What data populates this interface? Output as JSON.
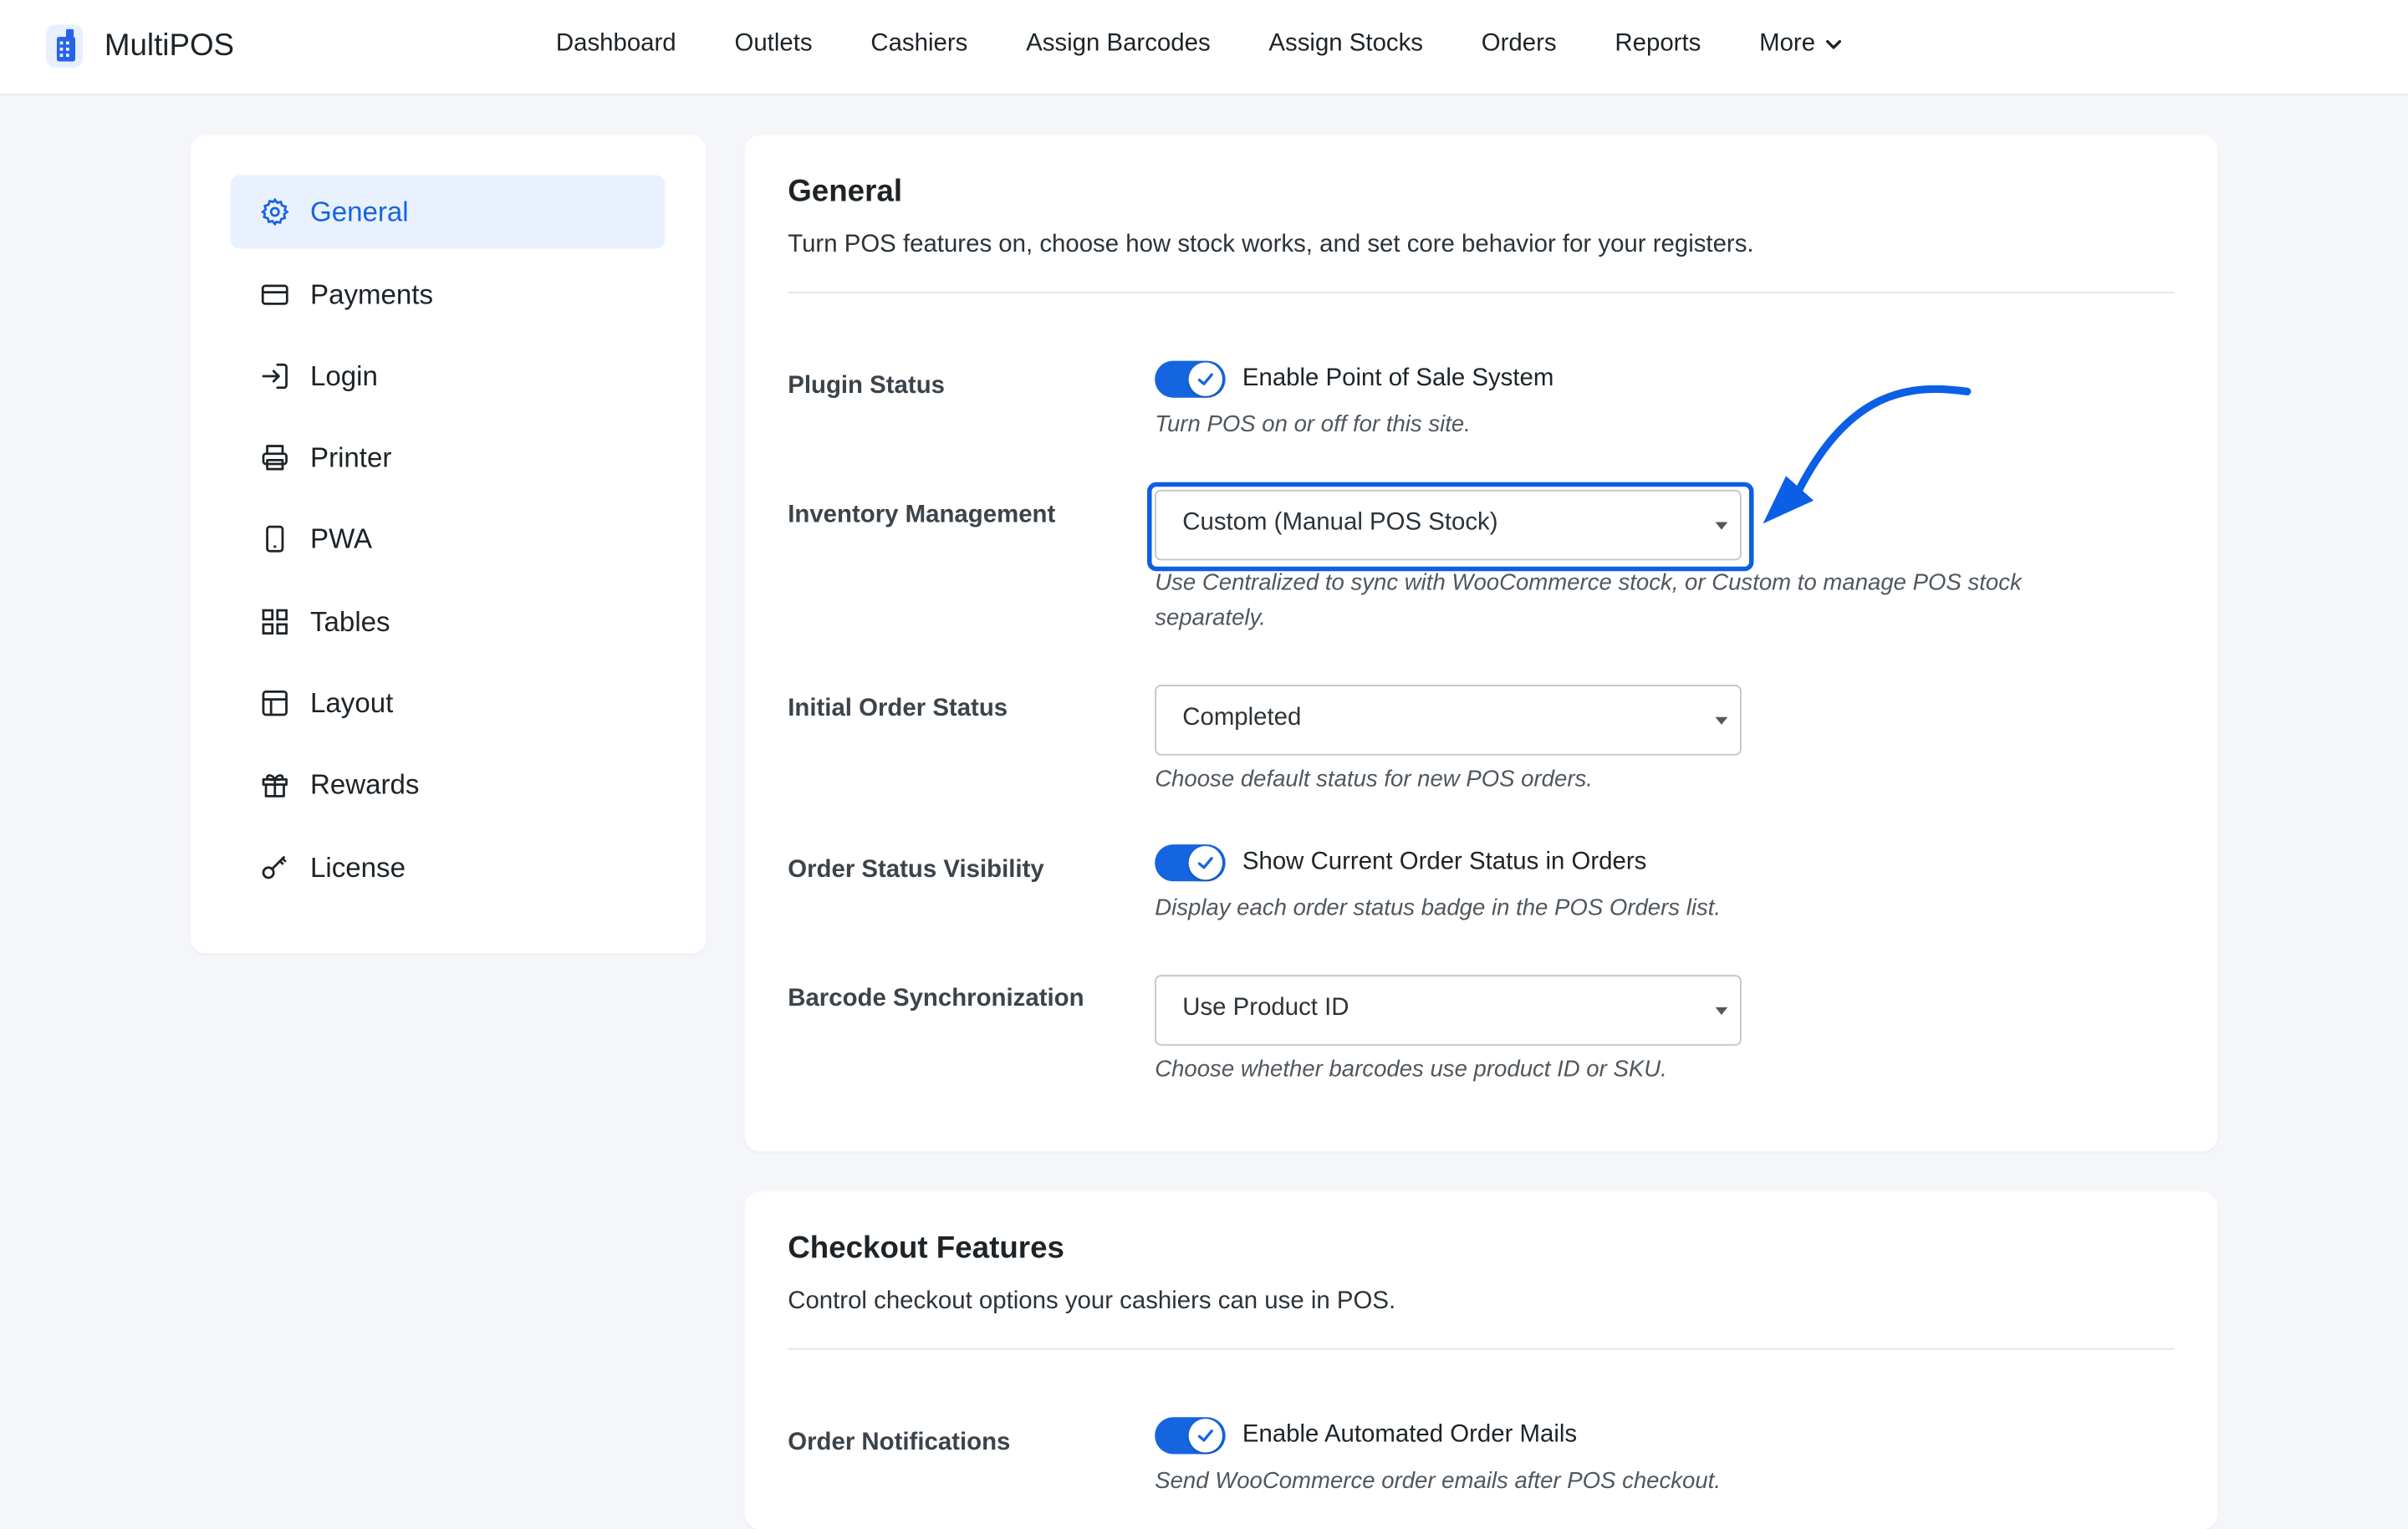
{
  "app": {
    "name": "MultiPOS",
    "logo_icon": "multipos-logo-icon"
  },
  "nav": {
    "items": [
      {
        "label": "Dashboard"
      },
      {
        "label": "Outlets"
      },
      {
        "label": "Cashiers"
      },
      {
        "label": "Assign Barcodes"
      },
      {
        "label": "Assign Stocks"
      },
      {
        "label": "Orders"
      },
      {
        "label": "Reports"
      },
      {
        "label": "More",
        "icon": "chevron-down-icon"
      }
    ]
  },
  "sidebar": {
    "items": [
      {
        "label": "General",
        "icon": "gear-icon",
        "active": true
      },
      {
        "label": "Payments",
        "icon": "credit-card-icon"
      },
      {
        "label": "Login",
        "icon": "login-icon"
      },
      {
        "label": "Printer",
        "icon": "printer-icon"
      },
      {
        "label": "PWA",
        "icon": "mobile-icon"
      },
      {
        "label": "Tables",
        "icon": "grid-icon"
      },
      {
        "label": "Layout",
        "icon": "layout-icon"
      },
      {
        "label": "Rewards",
        "icon": "gift-icon"
      },
      {
        "label": "License",
        "icon": "key-icon"
      }
    ]
  },
  "general": {
    "title": "General",
    "description": "Turn POS features on, choose how stock works, and set core behavior for your registers.",
    "plugin_status": {
      "label": "Plugin Status",
      "toggle_label": "Enable Point of Sale System",
      "enabled": true,
      "hint": "Turn POS on or off for this site."
    },
    "inventory": {
      "label": "Inventory Management",
      "value": "Custom (Manual POS Stock)",
      "hint": "Use Centralized to sync with WooCommerce stock, or Custom to manage POS stock separately."
    },
    "initial_order_status": {
      "label": "Initial Order Status",
      "value": "Completed",
      "hint": "Choose default status for new POS orders."
    },
    "order_status_visibility": {
      "label": "Order Status Visibility",
      "toggle_label": "Show Current Order Status in Orders",
      "enabled": true,
      "hint": "Display each order status badge in the POS Orders list."
    },
    "barcode_sync": {
      "label": "Barcode Synchronization",
      "value": "Use Product ID",
      "hint": "Choose whether barcodes use product ID or SKU."
    }
  },
  "checkout": {
    "title": "Checkout Features",
    "description": "Control checkout options your cashiers can use in POS.",
    "order_notifications": {
      "label": "Order Notifications",
      "toggle_label": "Enable Automated Order Mails",
      "enabled": true,
      "hint": "Send WooCommerce order emails after POS checkout."
    }
  },
  "colors": {
    "accent": "#1565e0",
    "annotation": "#0b5fe6"
  }
}
